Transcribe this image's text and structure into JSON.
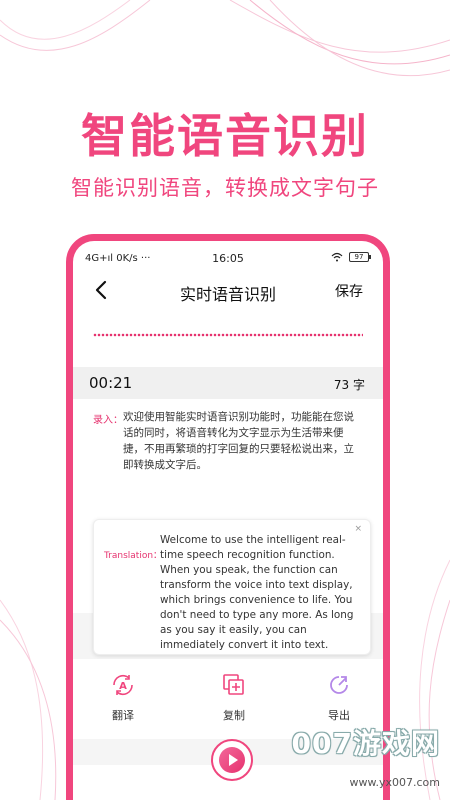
{
  "promo": {
    "title": "智能语音识别",
    "subtitle": "智能识别语音，转换成文字句子"
  },
  "status_bar": {
    "left": "4G+ıl 0K/s ···",
    "time": "16:05",
    "battery": "97"
  },
  "nav": {
    "title": "实时语音识别",
    "save_label": "保存",
    "back_icon": "chevron-left-icon"
  },
  "recording": {
    "elapsed": "00:21",
    "char_count": "73 字"
  },
  "transcript": {
    "label": "录入：",
    "text": "欢迎使用智能实时语音识别功能时，功能能在您说话的同时，将语音转化为文字显示为生活带来便捷，不用再繁琐的打字回复的只要轻松说出来，立即转换成文字后。"
  },
  "translation": {
    "label": "Translation：",
    "text": "Welcome to use the intelligent real-time speech recognition function. When you speak, the function can transform the voice into text display, which brings convenience to life. You don't need to type any more. As long as you say it easily, you can immediately convert it into text.",
    "close_label": "×"
  },
  "actions": [
    {
      "label": "翻译",
      "icon": "translate-icon"
    },
    {
      "label": "复制",
      "icon": "copy-icon"
    },
    {
      "label": "导出",
      "icon": "export-icon"
    }
  ],
  "watermark": {
    "brand": "007游戏网",
    "url": "www.yx007.com"
  },
  "colors": {
    "accent": "#f0467e",
    "accent_dark": "#e6336f"
  }
}
